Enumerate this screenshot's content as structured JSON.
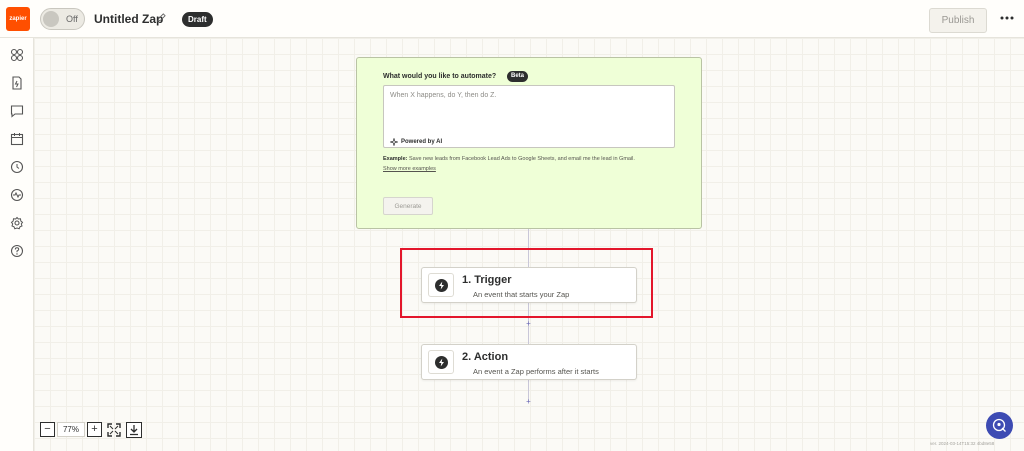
{
  "header": {
    "logo_text": "zapier",
    "toggle_label": "Off",
    "zap_title": "Untitled Zap",
    "status_badge": "Draft",
    "publish_label": "Publish"
  },
  "sidebar": {
    "items": [
      "apps-icon",
      "zap-file-icon",
      "comment-icon",
      "calendar-icon",
      "history-icon",
      "activity-icon",
      "settings-icon",
      "help-icon"
    ]
  },
  "ai_builder": {
    "heading": "What would you like to automate?",
    "badge": "Beta",
    "placeholder": "When X happens, do Y, then do Z.",
    "powered_by": "Powered by AI",
    "example_label": "Example:",
    "example_text": " Save new leads from Facebook Lead Ads to Google Sheets, and email me the lead in Gmail.",
    "show_more": "Show more examples",
    "generate_label": "Generate",
    "background": "#efffd7"
  },
  "steps": [
    {
      "title": "1. Trigger",
      "subtitle": "An event that starts your Zap"
    },
    {
      "title": "2. Action",
      "subtitle": "An event a Zap performs after it starts"
    }
  ],
  "zoom": {
    "minus": "−",
    "level": "77%",
    "plus": "+"
  },
  "footer": {
    "version": "ver. 2024-03-14T15:32 4bd8e58"
  },
  "colors": {
    "brand": "#ff4f00",
    "highlight": "#e3162b",
    "help_button": "#3d4bb3"
  }
}
